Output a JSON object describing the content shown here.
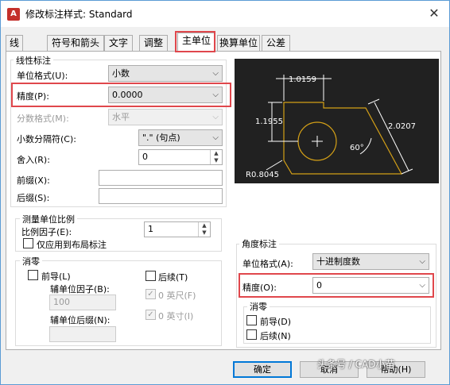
{
  "window": {
    "title": "修改标注样式: Standard",
    "close": "✕",
    "app_icon": "A"
  },
  "tabs": [
    {
      "label": "线"
    },
    {
      "label": "符号和箭头"
    },
    {
      "label": "文字"
    },
    {
      "label": "调整"
    },
    {
      "label": "主单位",
      "active": true
    },
    {
      "label": "换算单位"
    },
    {
      "label": "公差"
    }
  ],
  "linear": {
    "title": "线性标注",
    "unit_format": {
      "label": "单位格式(U):",
      "value": "小数"
    },
    "precision": {
      "label": "精度(P):",
      "value": "0.0000"
    },
    "fraction_format": {
      "label": "分数格式(M):",
      "value": "水平"
    },
    "decimal_separator": {
      "label": "小数分隔符(C):",
      "value": "\".\" (句点)"
    },
    "round_off": {
      "label": "舍入(R):",
      "value": "0"
    },
    "prefix": {
      "label": "前缀(X):",
      "value": ""
    },
    "suffix": {
      "label": "后缀(S):",
      "value": ""
    }
  },
  "scale": {
    "title": "测量单位比例",
    "factor": {
      "label": "比例因子(E):",
      "value": "1"
    },
    "layout_only": {
      "label": "仅应用到布局标注",
      "checked": false
    }
  },
  "zero_sup": {
    "title": "消零",
    "leading": {
      "label": "前导(L)",
      "checked": false
    },
    "trailing": {
      "label": "后续(T)",
      "checked": false
    },
    "sub_unit_factor": {
      "label": "辅单位因子(B):",
      "value": "100"
    },
    "feet": {
      "label": "0 英尺(F)",
      "checked": true
    },
    "sub_unit_suffix": {
      "label": "辅单位后缀(N):",
      "value": ""
    },
    "inches": {
      "label": "0 英寸(I)",
      "checked": true
    }
  },
  "angular": {
    "title": "角度标注",
    "unit_format": {
      "label": "单位格式(A):",
      "value": "十进制度数"
    },
    "precision": {
      "label": "精度(O):",
      "value": "0"
    },
    "zero_title": "消零",
    "leading": {
      "label": "前导(D)",
      "checked": false
    },
    "trailing": {
      "label": "后续(N)",
      "checked": false
    }
  },
  "preview": {
    "dim_top": "1.0159",
    "dim_left": "1.1955",
    "dim_right": "2.0207",
    "angle": "60°",
    "radius": "R0.8045"
  },
  "buttons": {
    "ok": "确定",
    "cancel": "取消",
    "help": "帮助(H)"
  },
  "watermark": "头条号 / CAD小苗",
  "icons": {
    "dropdown": "chevron-down-icon",
    "check": "✓",
    "spin_up": "▲",
    "spin_down": "▼",
    "arrow": "⌄"
  },
  "colors": {
    "highlight": "#e0474c",
    "preview_bg": "#212121",
    "preview_shape": "#d4a017",
    "preview_dim": "#ffffff"
  }
}
